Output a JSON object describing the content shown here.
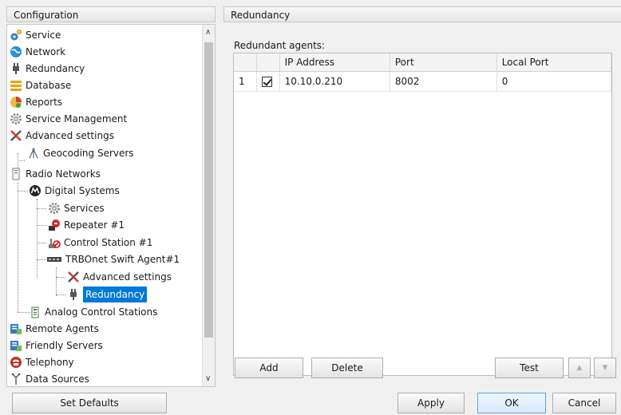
{
  "left_panel": {
    "title": "Configuration"
  },
  "right_panel": {
    "title": "Redundancy",
    "agents_label": "Redundant agents:"
  },
  "tree": {
    "items": [
      {
        "label": "Service",
        "icon": "gears-icon"
      },
      {
        "label": "Network",
        "icon": "globe-icon"
      },
      {
        "label": "Redundancy",
        "icon": "plug-icon"
      },
      {
        "label": "Database",
        "icon": "database-icon"
      },
      {
        "label": "Reports",
        "icon": "reports-icon"
      },
      {
        "label": "Service Management",
        "icon": "gear-icon"
      },
      {
        "label": "Advanced settings",
        "icon": "tools-icon"
      },
      {
        "label": "Geocoding Servers",
        "icon": "geocoding-icon"
      },
      {
        "label": "Radio Networks",
        "icon": "radio-networks-icon"
      },
      {
        "label": "Digital Systems",
        "icon": "motorola-icon"
      },
      {
        "label": "Services",
        "icon": "gear-icon"
      },
      {
        "label": "Repeater #1",
        "icon": "repeater-icon"
      },
      {
        "label": "Control Station #1",
        "icon": "control-station-icon"
      },
      {
        "label": "TRBOnet Swift Agent#1",
        "icon": "swift-agent-icon"
      },
      {
        "label": "Advanced settings",
        "icon": "tools-icon"
      },
      {
        "label": "Redundancy",
        "icon": "plug-icon"
      },
      {
        "label": "Analog Control Stations",
        "icon": "analog-icon"
      },
      {
        "label": "Remote Agents",
        "icon": "server-icon"
      },
      {
        "label": "Friendly Servers",
        "icon": "server-icon"
      },
      {
        "label": "Telephony",
        "icon": "telephone-icon"
      },
      {
        "label": "Data Sources",
        "icon": "data-sources-icon"
      }
    ]
  },
  "table": {
    "columns": [
      "",
      "",
      "IP Address",
      "Port",
      "Local Port"
    ],
    "rows": [
      {
        "index": "1",
        "checked": true,
        "ip": "10.10.0.210",
        "port": "8002",
        "local_port": "0"
      }
    ]
  },
  "buttons": {
    "add": "Add",
    "delete": "Delete",
    "test": "Test",
    "up": "▲",
    "down": "▼",
    "set_defaults": "Set Defaults",
    "apply": "Apply",
    "ok": "OK",
    "cancel": "Cancel"
  },
  "colors": {
    "selection": "#0078d7",
    "accent": "#3c78c8"
  }
}
